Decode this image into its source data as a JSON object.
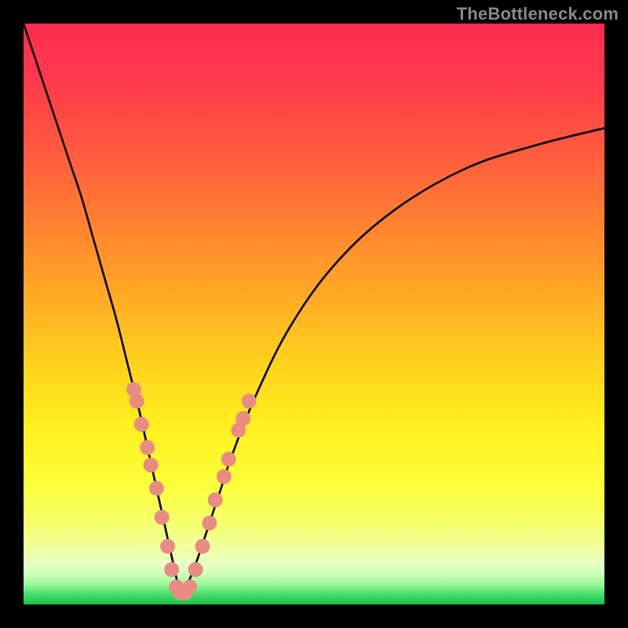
{
  "watermark": "TheBottleneck.com",
  "colors": {
    "black": "#000000",
    "curve": "#000000",
    "dot_fill": "#e98b85",
    "dot_stroke": "#cf6a63",
    "gradient_stops": [
      {
        "offset": 0.0,
        "color": "#ff2b52"
      },
      {
        "offset": 0.1,
        "color": "#ff3a4c"
      },
      {
        "offset": 0.22,
        "color": "#ff5a3e"
      },
      {
        "offset": 0.35,
        "color": "#ff8330"
      },
      {
        "offset": 0.48,
        "color": "#ffae24"
      },
      {
        "offset": 0.6,
        "color": "#ffd61c"
      },
      {
        "offset": 0.7,
        "color": "#fff120"
      },
      {
        "offset": 0.8,
        "color": "#fbff3c"
      },
      {
        "offset": 0.86,
        "color": "#f4ff6a"
      },
      {
        "offset": 0.905,
        "color": "#f0ffa0"
      },
      {
        "offset": 0.93,
        "color": "#e6ffc4"
      },
      {
        "offset": 0.95,
        "color": "#c8ffb8"
      },
      {
        "offset": 0.965,
        "color": "#9cf79a"
      },
      {
        "offset": 0.98,
        "color": "#4fe36e"
      },
      {
        "offset": 1.0,
        "color": "#16c24b"
      }
    ]
  },
  "chart_data": {
    "type": "line",
    "title": "",
    "xlabel": "",
    "ylabel": "",
    "xlim": [
      0,
      100
    ],
    "ylim": [
      0,
      100
    ],
    "note": "V-shaped bottleneck curve; y is bottleneck percentage (top ~100, bottom ~0). Minimum near x≈27.",
    "series": [
      {
        "name": "bottleneck-curve",
        "x": [
          0,
          2,
          4,
          6,
          8,
          10,
          12,
          14,
          16,
          18,
          20,
          22,
          24,
          26,
          27,
          28,
          30,
          32,
          34,
          36,
          40,
          46,
          54,
          64,
          76,
          88,
          100
        ],
        "y": [
          100,
          94,
          88,
          82,
          76,
          70,
          63,
          56,
          49,
          41,
          33,
          24,
          15,
          6,
          2,
          3,
          8,
          14,
          20,
          26,
          36,
          48,
          59,
          68,
          75,
          79,
          82
        ]
      }
    ],
    "highlight_points": {
      "name": "sample-dots",
      "points": [
        {
          "x": 19.0,
          "y": 37
        },
        {
          "x": 19.5,
          "y": 35
        },
        {
          "x": 20.3,
          "y": 31
        },
        {
          "x": 21.3,
          "y": 27
        },
        {
          "x": 21.9,
          "y": 24
        },
        {
          "x": 22.9,
          "y": 20
        },
        {
          "x": 23.8,
          "y": 15
        },
        {
          "x": 24.8,
          "y": 10
        },
        {
          "x": 25.5,
          "y": 6
        },
        {
          "x": 26.3,
          "y": 3
        },
        {
          "x": 27.0,
          "y": 2
        },
        {
          "x": 27.8,
          "y": 2
        },
        {
          "x": 28.6,
          "y": 3
        },
        {
          "x": 29.6,
          "y": 6
        },
        {
          "x": 30.8,
          "y": 10
        },
        {
          "x": 32.0,
          "y": 14
        },
        {
          "x": 33.0,
          "y": 18
        },
        {
          "x": 34.5,
          "y": 22
        },
        {
          "x": 35.3,
          "y": 25
        },
        {
          "x": 37.0,
          "y": 30
        },
        {
          "x": 37.8,
          "y": 32
        },
        {
          "x": 38.8,
          "y": 35
        }
      ]
    }
  }
}
